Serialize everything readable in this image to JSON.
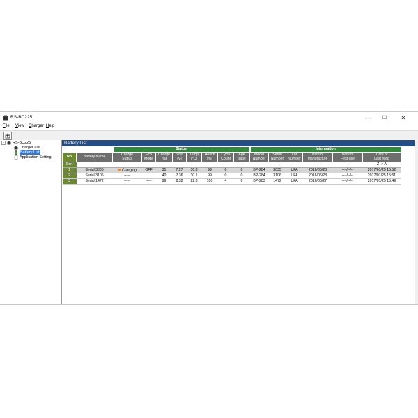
{
  "window": {
    "title": "RS-BC225",
    "controls": {
      "minimize": "—",
      "maximize": "☐",
      "close": "✕"
    }
  },
  "menu": [
    {
      "label": "File",
      "accel": "F",
      "rest": "ile"
    },
    {
      "label": "View",
      "accel": "V",
      "rest": "iew"
    },
    {
      "label": "Charger",
      "accel": "C",
      "rest": "harger"
    },
    {
      "label": "Help",
      "accel": "H",
      "rest": "elp"
    }
  ],
  "tree": {
    "root": "RS-BC225",
    "items": [
      "Charger List",
      "Battery List",
      "Application Setting"
    ],
    "selected": "Battery List"
  },
  "panel": {
    "title": "Battery List"
  },
  "table": {
    "groups": {
      "status": "Status",
      "information": "Information"
    },
    "columns": {
      "no": "No",
      "battery_name": "Battery Name",
      "charge_status": [
        "Charge",
        "Status"
      ],
      "eco_mode": [
        "Eco",
        "Mode"
      ],
      "charge": [
        "Charge",
        "[%]"
      ],
      "volt": [
        "Volt",
        "[V]"
      ],
      "temp": [
        "Temp",
        "[°C]"
      ],
      "health": [
        "Health",
        "[%]"
      ],
      "cycle_count": [
        "Cycle",
        "Count"
      ],
      "age": [
        "Age",
        "[day]"
      ],
      "model_number": [
        "Model",
        "Number"
      ],
      "serial_number": [
        "Serial",
        "Number"
      ],
      "lot_number": [
        "Lot",
        "Number"
      ],
      "date_of_manufacture": [
        "Date of",
        "Manufacture"
      ],
      "date_of_first_use": [
        "Date of",
        "First use"
      ],
      "date_of_last_read": [
        "Date of",
        "Last read"
      ]
    },
    "sort_row": {
      "label": "Sort",
      "placeholder": "-----",
      "last_read": "Z -> A"
    },
    "rows": [
      {
        "no": "1",
        "battery_name": "Serial 3035",
        "charge_status": "Charging",
        "eco_mode": "OFF",
        "charge": "31",
        "volt": "7.27",
        "temp": "30.8",
        "health": "99",
        "cycle_count": "0",
        "age": "0",
        "model_number": "BP-284",
        "serial_number": "3035",
        "lot_number": "UFA",
        "date_of_manufacture": "2016/06/28",
        "date_of_first_use": "----/--/--",
        "date_of_last_read": "2017/01/25 15:52"
      },
      {
        "no": "2",
        "battery_name": "Serial 3106",
        "charge_status": "-----",
        "eco_mode": "",
        "charge": "40",
        "volt": "7.36",
        "temp": "30.1",
        "health": "99",
        "cycle_count": "0",
        "age": "0",
        "model_number": "BP-284",
        "serial_number": "3106",
        "lot_number": "UFA",
        "date_of_manufacture": "2016/06/28",
        "date_of_first_use": "----/--/--",
        "date_of_last_read": "2017/01/25 15:51"
      },
      {
        "no": "3",
        "battery_name": "Serial 1472",
        "charge_status": "-----",
        "eco_mode": "-----",
        "charge": "99",
        "volt": "8.32",
        "temp": "22.8",
        "health": "100",
        "cycle_count": "4",
        "age": "0",
        "model_number": "BP-283",
        "serial_number": "1472",
        "lot_number": "UFA",
        "date_of_manufacture": "2016/06/27",
        "date_of_first_use": "----/--/--",
        "date_of_last_read": "2017/01/25 15:49"
      }
    ]
  },
  "colors": {
    "panel_header": "#1f4e8c",
    "group_header": "#2e8b3a",
    "column_header": "#6e6e6e",
    "row_number": "#6b8a2c",
    "charging_dot": "#f08c1e",
    "tree_selection": "#3377dd"
  }
}
